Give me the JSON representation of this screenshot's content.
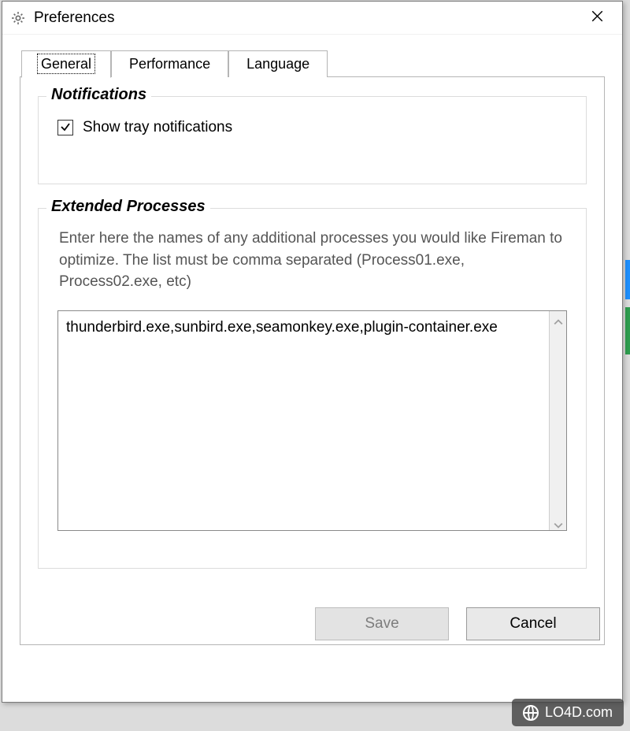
{
  "window": {
    "title": "Preferences"
  },
  "tabs": [
    {
      "label": "General",
      "active": true
    },
    {
      "label": "Performance",
      "active": false
    },
    {
      "label": "Language",
      "active": false
    }
  ],
  "notifications": {
    "legend": "Notifications",
    "show_tray_label": "Show tray notifications",
    "show_tray_checked": true
  },
  "extended": {
    "legend": "Extended Processes",
    "description": "Enter here the names of any additional processes you would like Fireman to optimize. The list must be comma separated (Process01.exe, Process02.exe, etc)",
    "value": "thunderbird.exe,sunbird.exe,seamonkey.exe,plugin-container.exe"
  },
  "buttons": {
    "save_label": "Save",
    "cancel_label": "Cancel"
  },
  "watermark": {
    "text": "LO4D.com"
  }
}
